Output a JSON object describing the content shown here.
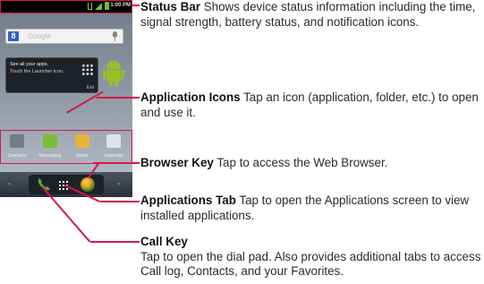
{
  "phone": {
    "status_time": "1:00 PM",
    "search_placeholder": "Google",
    "search_logo": "8",
    "widget_line1": "See all your apps.",
    "widget_line2": "Touch the Launcher icon.",
    "widget_exit": "Exit",
    "apps": [
      {
        "label": "Contacts",
        "icon": "contacts-icon",
        "color": "#6f7f8a"
      },
      {
        "label": "Messaging",
        "icon": "messaging-icon",
        "color": "#7dbb3a"
      },
      {
        "label": "Email",
        "icon": "email-icon",
        "color": "#e7b33a"
      },
      {
        "label": "Calendar",
        "icon": "calendar-icon",
        "color": "#dfe3e8"
      }
    ],
    "bar_left_arrow": "«",
    "bar_right_arrow": "»"
  },
  "accent_color": "#d5184a",
  "callouts": {
    "status_bar": {
      "title": "Status Bar",
      "text": "Shows device status information including the time, signal strength, battery status, and notification icons."
    },
    "application_icons": {
      "title": "Application Icons",
      "text": "Tap an icon (application, folder, etc.) to open and use it."
    },
    "browser_key": {
      "title": "Browser Key",
      "text": "Tap to access the Web Browser."
    },
    "applications_tab": {
      "title": "Applications Tab",
      "text": "Tap to open the Applications screen to view installed applications."
    },
    "call_key": {
      "title": "Call Key",
      "text": "Tap to open the dial pad. Also provides additional tabs to access Call log, Contacts, and your Favorites."
    }
  }
}
